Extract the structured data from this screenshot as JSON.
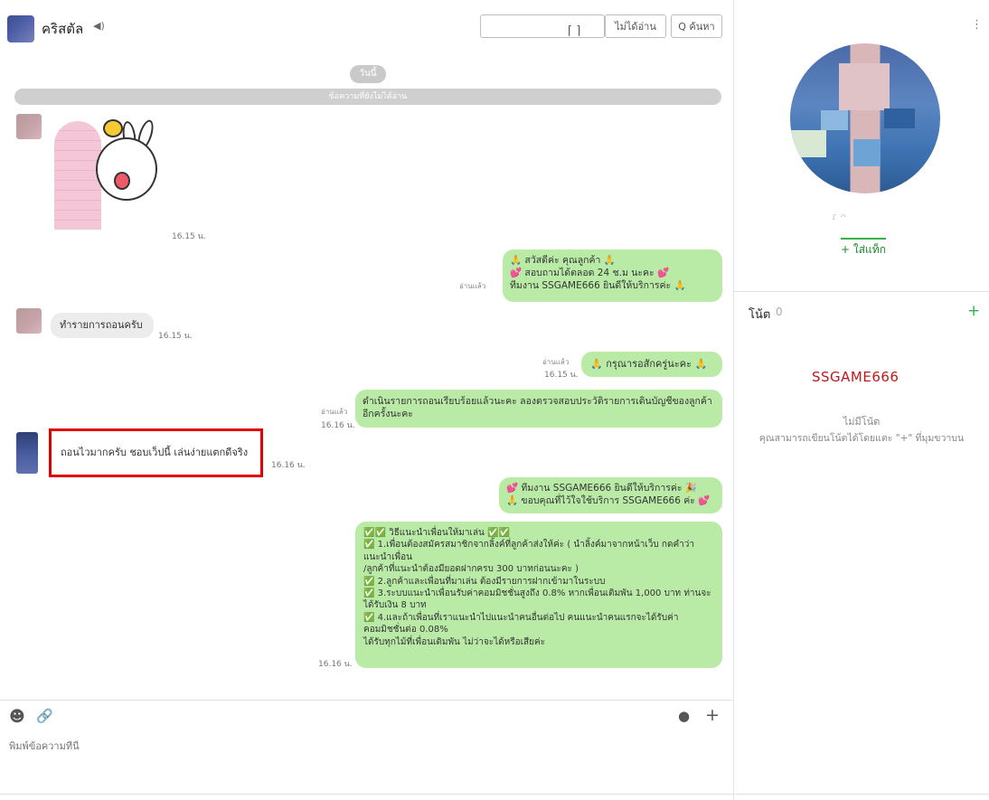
{
  "header": {
    "title": "คริสตัล",
    "speaker_icon": "◀︎)",
    "read_button": "ไม่ได้อ่าน",
    "search_button": "Q ค้นหา"
  },
  "chat": {
    "day_label": "วันนี้",
    "unread_label": "ข้อความที่ยังไม่ได้อ่าน",
    "messages": [
      {
        "time": "16.15 น."
      },
      {
        "text": "🙏 สวัสดีค่ะ คุณลูกค้า 🙏\n💕 สอบถามได้ตลอด 24 ช.ม นะคะ 💕\nทีมงาน SSGAME666 ยินดีให้บริการค่ะ 🙏",
        "read": "อ่านแล้ว"
      },
      {
        "text": "ทำรายการถอนครับ",
        "time": "16.15 น."
      },
      {
        "text": "🙏 กรุณารอสักครู่นะคะ 🙏",
        "read": "อ่านแล้ว",
        "time": "16.15 น."
      },
      {
        "text": "ดำเนินรายการถอนเรียบร้อยแล้วนะคะ ลองตรวจสอบประวัติรายการเดินบัญชีของลูกค้าอีกครั้งนะคะ",
        "read": "อ่านแล้ว",
        "time": "16.16 น."
      },
      {
        "text": "ถอนไวมากครับ ชอบเว็ปนี้ เล่นง่ายแตกดีจริง",
        "time": "16.16 น."
      },
      {
        "text": "💕 ทีมงาน SSGAME666 ยินดีให้บริการค่ะ 🎉\n🙏 ขอบคุณที่ไว้ใจใช้บริการ SSGAME666 ค่ะ 💕"
      },
      {
        "text": "✅✅ วิธีแนะนำเพื่อนให้มาเล่น ✅✅\n✅ 1.เพื่อนต้องสมัครสมาชิกจากลิ้งค์ที่ลูกค้าส่งให้ค่ะ ( นำลิ้งค์มาจากหน้าเว็บ กดคำว่าแนะนำเพื่อน\n/ลูกค้าที่แนะนำต้องมียอดฝากครบ 300 บาทก่อนนะคะ )\n✅ 2.ลูกค้าและเพื่อนที่มาเล่น ต้องมีรายการฝากเข้ามาในระบบ\n✅ 3.ระบบแนะนำเพื่อนรับค่าคอมมิชชั่นสูงถึง 0.8% หากเพื่อนเติมพัน 1,000 บาท ท่านจะได้รับเงิน 8 บาท\n✅ 4.และถ้าเพื่อนที่เราแนะนำไปแนะนำคนอื่นต่อไป คนแนะนำคนแรกจะได้รับค่าคอมมิชชั่นต่อ 0.08%\nได้รับทุกไม้ที่เพื่อนเดิมพัน ไม่ว่าจะได้หรือเสียค่ะ",
        "time": "16.16 น."
      }
    ]
  },
  "composer": {
    "placeholder": "พิมพ์ข้อความที่นี่",
    "emoji_icon": "☻",
    "attach_icon": "🔗",
    "chat_icon": "●",
    "plus_icon": "+"
  },
  "profile": {
    "name": "ɾ  ᴖ",
    "tag_link": "+ ใส่แท็ก",
    "menu_icon": "⋮"
  },
  "notes": {
    "title": "โน้ต",
    "count": "0",
    "add_icon": "+",
    "brand": "SSGAME666",
    "empty": "ไม่มีโน้ต",
    "hint": "คุณสามารถเขียนโน้ตได้โดยแตะ \"+\" ที่มุมขวาบน"
  }
}
